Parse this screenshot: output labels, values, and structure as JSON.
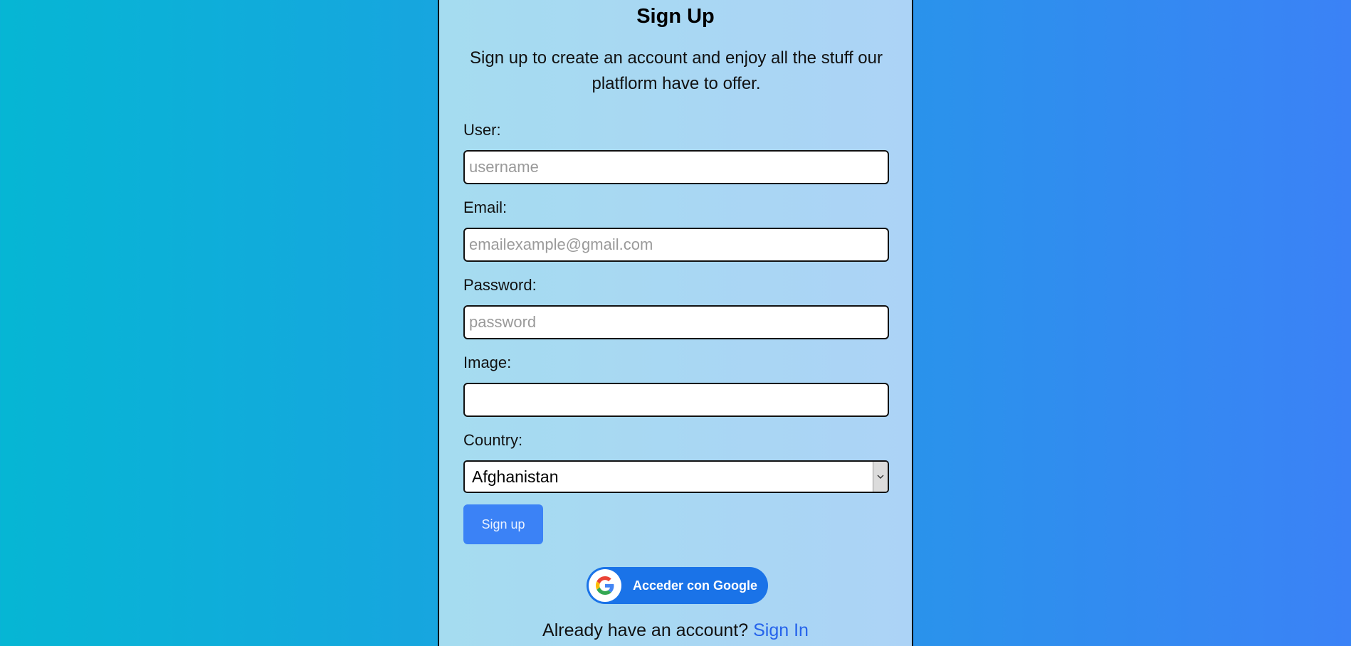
{
  "form": {
    "title": "Sign Up",
    "subtitle": "Sign up to create an account and enjoy all the stuff our platflorm have to offer.",
    "user_label": "User:",
    "user_placeholder": "username",
    "email_label": "Email:",
    "email_placeholder": "emailexample@gmail.com",
    "password_label": "Password:",
    "password_placeholder": "password",
    "image_label": "Image:",
    "image_value": "",
    "country_label": "Country:",
    "country_selected": "Afghanistan",
    "submit_label": "Sign up",
    "google_label": "Acceder con Google",
    "already_text": "Already have an account?",
    "signin_label": "Sign In"
  },
  "colors": {
    "page_gradient_start": "#06b6d4",
    "page_gradient_end": "#3b82f6",
    "primary_button": "#3b82f6",
    "google_button": "#1a73e8",
    "link": "#2563eb"
  },
  "icons": {
    "google": "google-g-icon",
    "select_arrow": "chevron-down-icon"
  }
}
